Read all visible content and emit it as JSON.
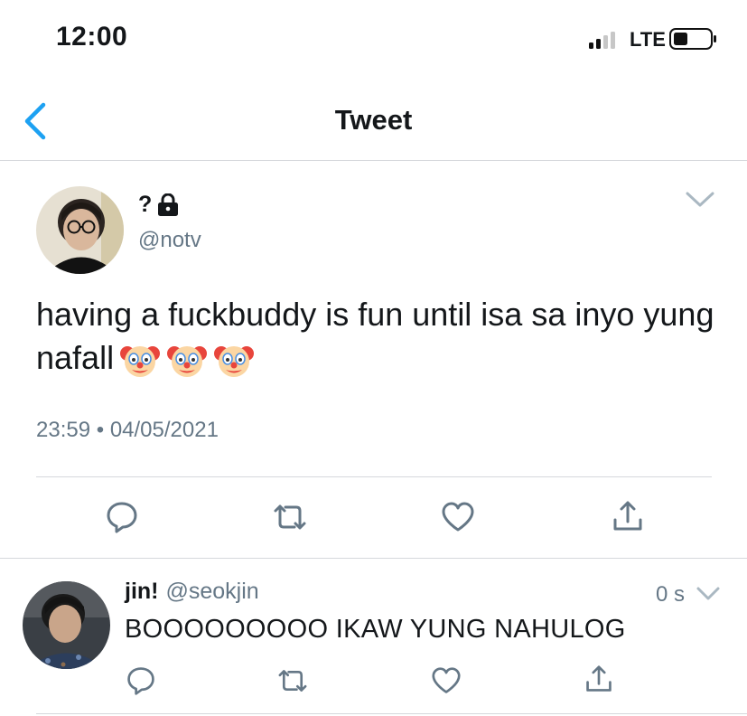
{
  "status_bar": {
    "time": "12:00",
    "network": "LTE",
    "signal_bars_active": 2,
    "signal_bars_total": 4
  },
  "nav": {
    "title": "Tweet",
    "back_icon": "chevron-left-icon"
  },
  "tweet": {
    "display_name": "?",
    "lock_icon": "lock-icon",
    "handle": "@notv",
    "text": "having a fuckbuddy is fun until isa sa inyo yung nafall",
    "emoji_count": 3,
    "emoji_icon": "clown-face-icon",
    "time": "23:59",
    "separator": "•",
    "date": "04/05/2021"
  },
  "actions": [
    "reply-icon",
    "retweet-icon",
    "like-icon",
    "share-icon"
  ],
  "reply": {
    "display_name": "jin!",
    "handle": "@seokjin",
    "time": "0 s",
    "text": "BOOOOOOOOO IKAW YUNG NAHULOG"
  },
  "colors": {
    "accent": "#1da1f2",
    "text": "#14171a",
    "secondary": "#657786",
    "icon": "#657786",
    "divider": "#d5d8dc"
  }
}
